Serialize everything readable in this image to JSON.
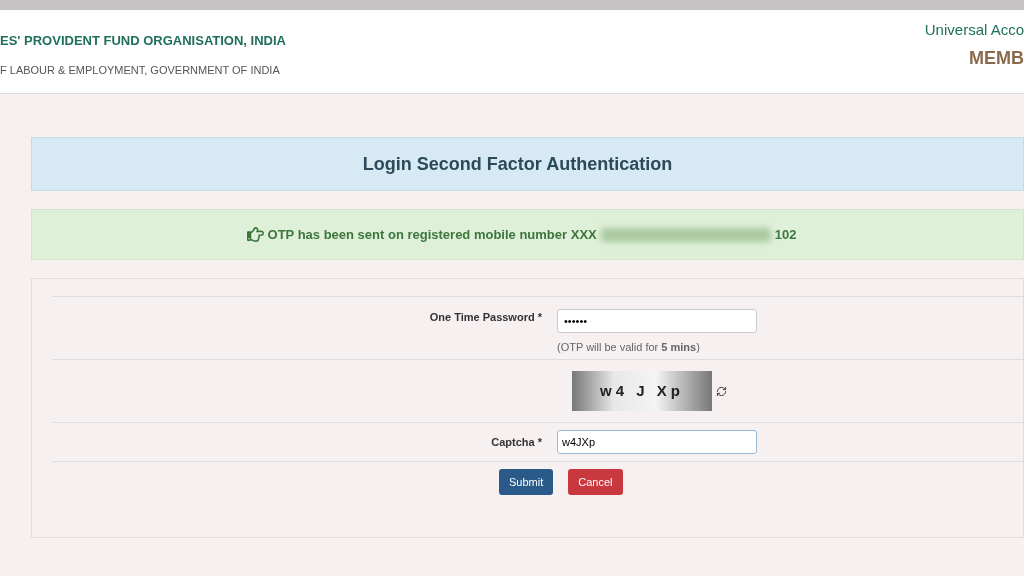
{
  "header": {
    "org_name": "ES' PROVIDENT FUND ORGANISATION, INDIA",
    "ministry": "F LABOUR & EMPLOYMENT, GOVERNMENT OF INDIA",
    "portal_title": "Universal Acco",
    "portal_subtitle": "MEMB"
  },
  "panel_title": "Login Second Factor Authentication",
  "alert": {
    "message": "OTP has been sent on registered mobile number XXX",
    "message_end": "102"
  },
  "form": {
    "otp": {
      "label": "One Time Password *",
      "value": "••••••",
      "hint": "(OTP will be valid for **5 mins**)"
    },
    "captcha_image": {
      "text": "w4 J Xp"
    },
    "captcha": {
      "label": "Captcha *",
      "value": "w4JXp"
    },
    "buttons": [
      {
        "kind": "primary",
        "label": "Submit"
      },
      {
        "kind": "danger",
        "label": "Cancel"
      }
    ]
  }
}
